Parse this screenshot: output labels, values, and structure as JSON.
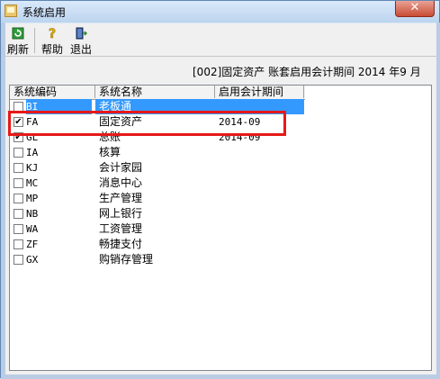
{
  "window": {
    "title": "系统启用",
    "close_label": "✕"
  },
  "toolbar": {
    "refresh_label": "刷新",
    "help_label": "帮助",
    "exit_label": "退出"
  },
  "info_text": "[002]固定资产 账套启用会计期间 2014 年9 月",
  "table": {
    "columns": [
      "系统编码",
      "系统名称",
      "启用会计期间"
    ],
    "rows": [
      {
        "checked": false,
        "code": "BI",
        "name": "老板通",
        "period": "",
        "selected": true
      },
      {
        "checked": true,
        "code": "FA",
        "name": "固定资产",
        "period": "2014-09",
        "selected": false
      },
      {
        "checked": true,
        "code": "GL",
        "name": "总账",
        "period": "2014-09",
        "selected": false
      },
      {
        "checked": false,
        "code": "IA",
        "name": "核算",
        "period": "",
        "selected": false
      },
      {
        "checked": false,
        "code": "KJ",
        "name": "会计家园",
        "period": "",
        "selected": false
      },
      {
        "checked": false,
        "code": "MC",
        "name": "消息中心",
        "period": "",
        "selected": false
      },
      {
        "checked": false,
        "code": "MP",
        "name": "生产管理",
        "period": "",
        "selected": false
      },
      {
        "checked": false,
        "code": "NB",
        "name": "网上银行",
        "period": "",
        "selected": false
      },
      {
        "checked": false,
        "code": "WA",
        "name": "工资管理",
        "period": "",
        "selected": false
      },
      {
        "checked": false,
        "code": "ZF",
        "name": "畅捷支付",
        "period": "",
        "selected": false
      },
      {
        "checked": false,
        "code": "GX",
        "name": "购销存管理",
        "period": "",
        "selected": false
      }
    ]
  },
  "colors": {
    "selection": "#3399ff",
    "highlight": "#e61919",
    "titlebar": "#c6dcf5"
  }
}
